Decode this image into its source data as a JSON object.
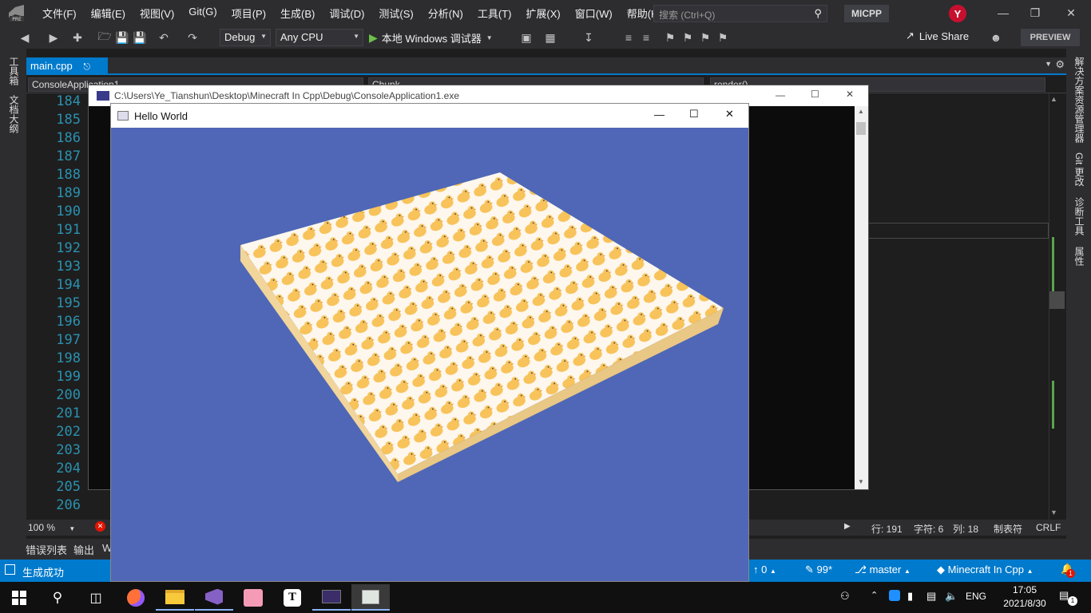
{
  "menu": {
    "logo_badge": "PRE",
    "items": [
      "文件(F)",
      "编辑(E)",
      "视图(V)",
      "Git(G)",
      "项目(P)",
      "生成(B)",
      "调试(D)",
      "测试(S)",
      "分析(N)",
      "工具(T)",
      "扩展(X)",
      "窗口(W)",
      "帮助(H)"
    ],
    "search_placeholder": "搜索 (Ctrl+Q)",
    "solution_name": "MICPP",
    "avatar_letter": "Y"
  },
  "toolbar": {
    "config": "Debug",
    "platform": "Any CPU",
    "run_label": "本地 Windows 调试器",
    "live_share": "Live Share",
    "preview": "PREVIEW"
  },
  "left_strip": {
    "tabs": [
      "工具箱",
      "文档大纲"
    ]
  },
  "right_strip": {
    "tabs": [
      "解决方案资源管理器",
      "Git 更改",
      "诊断工具",
      "属性"
    ]
  },
  "editor": {
    "tab_label": "main.cpp",
    "nav_project": "ConsoleApplication1",
    "nav_scope": "Chunk",
    "nav_member": "render()",
    "line_numbers": [
      "184",
      "185",
      "186",
      "187",
      "188",
      "189",
      "190",
      "191",
      "192",
      "193",
      "194",
      "195",
      "196",
      "197",
      "198",
      "199",
      "200",
      "201",
      "202",
      "203",
      "204",
      "205",
      "206"
    ]
  },
  "editor_status": {
    "zoom": "100 %",
    "line": "行: 191",
    "char": "字符: 6",
    "col": "列: 18",
    "tabs": "制表符",
    "eol": "CRLF"
  },
  "output_tabs": [
    "错误列表",
    "输出",
    "W"
  ],
  "statusbar": {
    "build_status": "生成成功",
    "push_count": "0",
    "changes": "99*",
    "branch": "master",
    "repo": "Minecraft In Cpp",
    "notifications": "1"
  },
  "console_window": {
    "title": "C:\\Users\\Ye_Tianshun\\Desktop\\Minecraft In Cpp\\Debug\\ConsoleApplication1.exe"
  },
  "hello_window": {
    "title": "Hello World"
  },
  "taskbar": {
    "language": "ENG",
    "time": "17:05",
    "date": "2021/8/30",
    "notification_count": "1"
  },
  "colors": {
    "accent": "#007acc",
    "gl_background": "#4f67b6",
    "duck_yellow": "#f7c35a"
  }
}
